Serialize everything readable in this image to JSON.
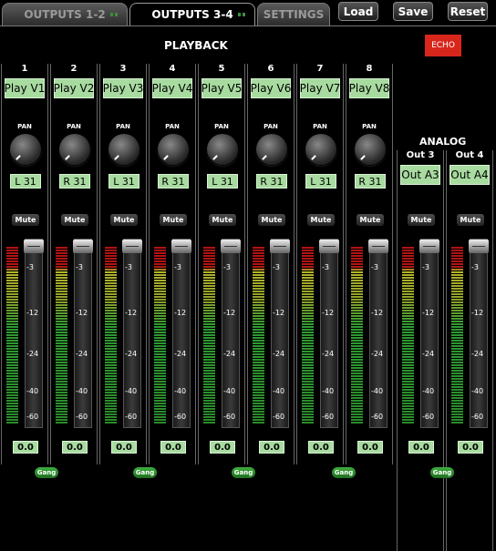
{
  "tabs": [
    {
      "label": "OUTPUTS 1-2",
      "active": false
    },
    {
      "label": "OUTPUTS 3-4",
      "active": true
    },
    {
      "label": "SETTINGS",
      "active": false
    }
  ],
  "toolbar": {
    "load": "Load",
    "save": "Save",
    "reset": "Reset"
  },
  "playback": {
    "title": "PLAYBACK",
    "echo": "ECHO",
    "channels": [
      {
        "num": "1",
        "name": "Play V1",
        "pan_label": "PAN",
        "pan": "L 31",
        "mute": "Mute",
        "level": "0.0"
      },
      {
        "num": "2",
        "name": "Play V2",
        "pan_label": "PAN",
        "pan": "R 31",
        "mute": "Mute",
        "level": "0.0"
      },
      {
        "num": "3",
        "name": "Play V3",
        "pan_label": "PAN",
        "pan": "L 31",
        "mute": "Mute",
        "level": "0.0"
      },
      {
        "num": "4",
        "name": "Play V4",
        "pan_label": "PAN",
        "pan": "R 31",
        "mute": "Mute",
        "level": "0.0"
      },
      {
        "num": "5",
        "name": "Play V5",
        "pan_label": "PAN",
        "pan": "L 31",
        "mute": "Mute",
        "level": "0.0"
      },
      {
        "num": "6",
        "name": "Play V6",
        "pan_label": "PAN",
        "pan": "R 31",
        "mute": "Mute",
        "level": "0.0"
      },
      {
        "num": "7",
        "name": "Play V7",
        "pan_label": "PAN",
        "pan": "L 31",
        "mute": "Mute",
        "level": "0.0"
      },
      {
        "num": "8",
        "name": "Play V8",
        "pan_label": "PAN",
        "pan": "R 31",
        "mute": "Mute",
        "level": "0.0"
      }
    ],
    "gang": "Gang"
  },
  "analog": {
    "title": "ANALOG",
    "channels": [
      {
        "num": "Out 3",
        "name": "Out A3",
        "mute": "Mute",
        "level": "0.0"
      },
      {
        "num": "Out 4",
        "name": "Out A4",
        "mute": "Mute",
        "level": "0.0"
      }
    ],
    "gang": "Gang"
  },
  "scale": [
    "-3",
    "-12",
    "-24",
    "-40",
    "-60"
  ],
  "colors": {
    "accent_green": "#a8dba0",
    "echo_red": "#d8261c",
    "gang_green": "#3fae3f"
  }
}
